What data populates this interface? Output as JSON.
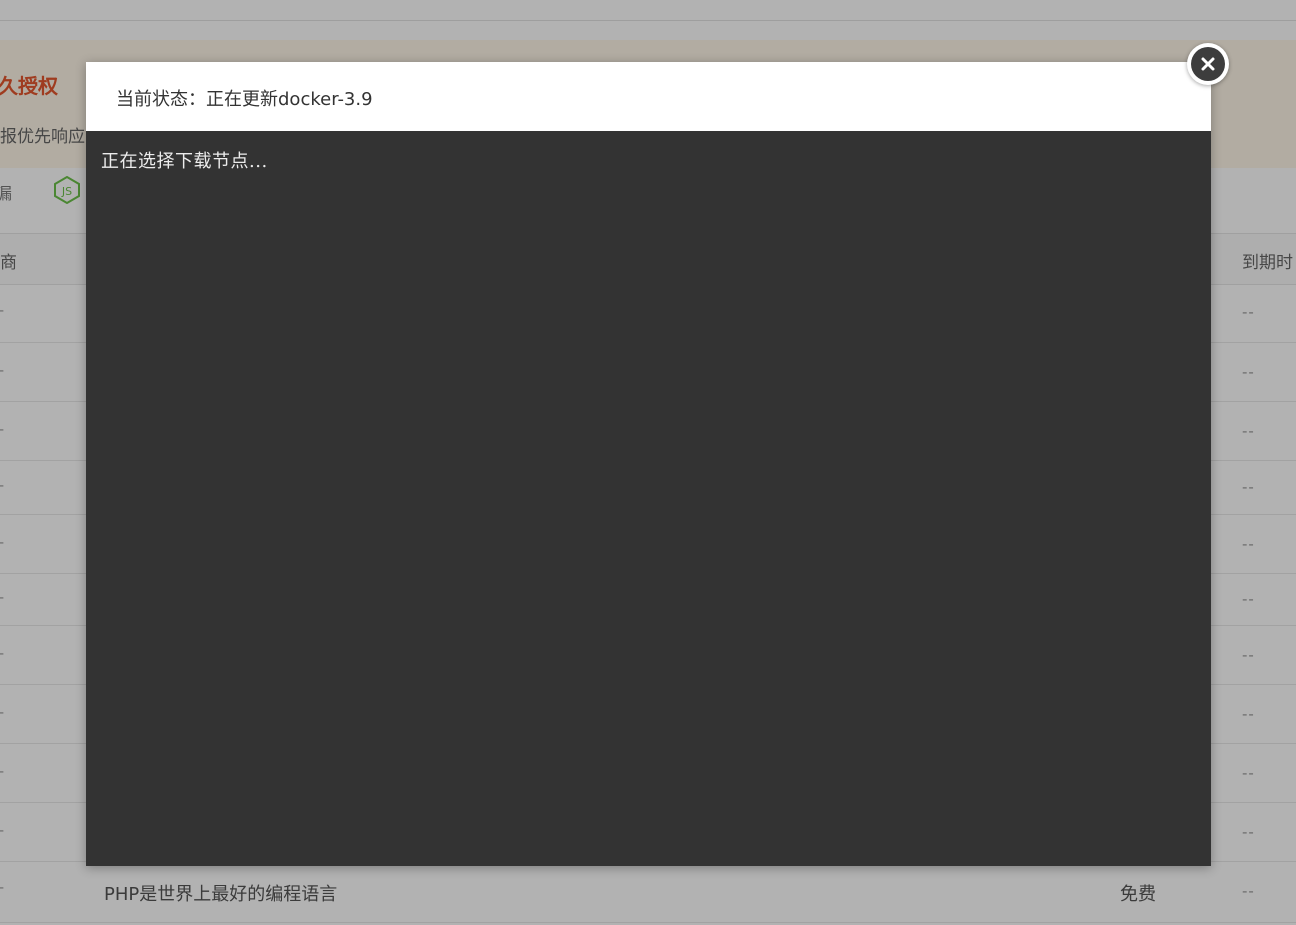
{
  "background": {
    "promo_title": "久授权",
    "promo_desc": "报优先响应",
    "env_label": "漏",
    "env_icon": "nodejs-icon",
    "table": {
      "header_left": "商",
      "header_right": "到期时",
      "row_left_dash": "-",
      "row_expire": "--",
      "last_row": {
        "name": "PHP是世界上最好的编程语言",
        "price": "免费",
        "expire": "--"
      }
    }
  },
  "dialog": {
    "title": "当前状态：正在更新docker-3.9",
    "terminal_output": "正在选择下载节点...",
    "close_icon": "close-icon"
  },
  "colors": {
    "accent": "#e4572e",
    "terminal_bg": "#333333",
    "overlay": "rgba(0,0,0,0.30)"
  }
}
